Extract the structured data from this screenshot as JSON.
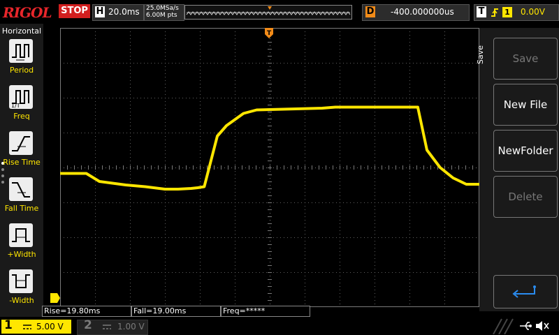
{
  "brand": "RIGOL",
  "run_state": "STOP",
  "horizontal": {
    "label": "H",
    "timebase": "20.0ms"
  },
  "sample": {
    "rate": "25.0MSa/s",
    "points": "6.00M pts"
  },
  "delay": {
    "label": "D",
    "value": "-400.000000us"
  },
  "trigger": {
    "label": "T",
    "source": "1",
    "level": "0.00V"
  },
  "left_menu": {
    "title": "Horizontal",
    "items": [
      {
        "label": "Period",
        "icon": "period-icon"
      },
      {
        "label": "Freq",
        "icon": "freq-icon"
      },
      {
        "label": "Rise Time",
        "icon": "rise-time-icon"
      },
      {
        "label": "Fall Time",
        "icon": "fall-time-icon"
      },
      {
        "label": "+Width",
        "icon": "positive-width-icon"
      },
      {
        "label": "-Width",
        "icon": "negative-width-icon"
      }
    ]
  },
  "measurements": {
    "rise": "Rise=19.80ms",
    "fall": "Fall=19.00ms",
    "freq": "Freq=*****"
  },
  "right_menu": {
    "title": "Save",
    "buttons": [
      {
        "label": "Save",
        "enabled": false
      },
      {
        "label": "New File",
        "enabled": true
      },
      {
        "label": "NewFolder",
        "enabled": true
      },
      {
        "label": "Delete",
        "enabled": false
      }
    ]
  },
  "channels": [
    {
      "number": "1",
      "scale": "5.00 V",
      "active": true
    },
    {
      "number": "2",
      "scale": "1.00 V",
      "active": false
    }
  ],
  "colors": {
    "ch1": "#ffe600",
    "trigger_marker": "#f28b18",
    "stop": "#d21f1f",
    "grid": "#7a7a7a"
  },
  "waveform": {
    "time": [
      0,
      2,
      3,
      5,
      6.5,
      8,
      9,
      10,
      10.5,
      11,
      12,
      12.7,
      14,
      15,
      20,
      21,
      26,
      27.3,
      28,
      29,
      30,
      31,
      32
    ],
    "volts": [
      -0.17,
      -0.17,
      -0.4,
      -0.5,
      -0.55,
      -0.62,
      -0.62,
      -0.6,
      -0.58,
      -0.55,
      0.9,
      1.2,
      1.55,
      1.65,
      1.7,
      1.73,
      1.73,
      1.73,
      0.5,
      0.0,
      -0.3,
      -0.48,
      -0.48
    ]
  }
}
